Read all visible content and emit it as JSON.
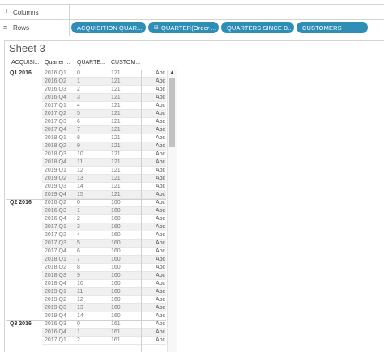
{
  "shelves": {
    "columns": {
      "label": "Columns",
      "icon": "columns-icon"
    },
    "rows": {
      "label": "Rows",
      "icon": "rows-icon",
      "pills": [
        {
          "label": "ACQUISITION QUAR...",
          "icon": ""
        },
        {
          "label": "QUARTER(Order ...",
          "icon": "calendar-icon"
        },
        {
          "label": "QUARTERS SINCE B...",
          "icon": ""
        },
        {
          "label": "CUSTOMERS",
          "icon": ""
        }
      ]
    }
  },
  "sheet": {
    "title": "Sheet 3",
    "headers": [
      "ACQUISI...",
      "Quarter ...",
      "QUARTE...",
      "CUSTOM..."
    ],
    "groups": [
      {
        "label": "Q1 2016",
        "rows": [
          [
            "2016 Q1",
            "0",
            "121",
            "Abc"
          ],
          [
            "2016 Q2",
            "1",
            "121",
            "Abc"
          ],
          [
            "2016 Q3",
            "2",
            "121",
            "Abc"
          ],
          [
            "2016 Q4",
            "3",
            "121",
            "Abc"
          ],
          [
            "2017 Q1",
            "4",
            "121",
            "Abc"
          ],
          [
            "2017 Q2",
            "5",
            "121",
            "Abc"
          ],
          [
            "2017 Q3",
            "6",
            "121",
            "Abc"
          ],
          [
            "2017 Q4",
            "7",
            "121",
            "Abc"
          ],
          [
            "2018 Q1",
            "8",
            "121",
            "Abc"
          ],
          [
            "2018 Q2",
            "9",
            "121",
            "Abc"
          ],
          [
            "2018 Q3",
            "10",
            "121",
            "Abc"
          ],
          [
            "2018 Q4",
            "11",
            "121",
            "Abc"
          ],
          [
            "2019 Q1",
            "12",
            "121",
            "Abc"
          ],
          [
            "2019 Q2",
            "13",
            "121",
            "Abc"
          ],
          [
            "2019 Q3",
            "14",
            "121",
            "Abc"
          ],
          [
            "2019 Q4",
            "15",
            "121",
            "Abc"
          ]
        ]
      },
      {
        "label": "Q2 2016",
        "rows": [
          [
            "2016 Q2",
            "0",
            "160",
            "Abc"
          ],
          [
            "2016 Q3",
            "1",
            "160",
            "Abc"
          ],
          [
            "2016 Q4",
            "2",
            "160",
            "Abc"
          ],
          [
            "2017 Q1",
            "3",
            "160",
            "Abc"
          ],
          [
            "2017 Q2",
            "4",
            "160",
            "Abc"
          ],
          [
            "2017 Q3",
            "5",
            "160",
            "Abc"
          ],
          [
            "2017 Q4",
            "6",
            "160",
            "Abc"
          ],
          [
            "2018 Q1",
            "7",
            "160",
            "Abc"
          ],
          [
            "2018 Q2",
            "8",
            "160",
            "Abc"
          ],
          [
            "2018 Q3",
            "9",
            "160",
            "Abc"
          ],
          [
            "2018 Q4",
            "10",
            "160",
            "Abc"
          ],
          [
            "2019 Q1",
            "11",
            "160",
            "Abc"
          ],
          [
            "2019 Q2",
            "12",
            "160",
            "Abc"
          ],
          [
            "2019 Q3",
            "13",
            "160",
            "Abc"
          ],
          [
            "2019 Q4",
            "14",
            "160",
            "Abc"
          ]
        ]
      },
      {
        "label": "Q3 2016",
        "rows": [
          [
            "2016 Q3",
            "0",
            "161",
            "Abc"
          ],
          [
            "2016 Q4",
            "1",
            "161",
            "Abc"
          ],
          [
            "2017 Q1",
            "2",
            "161",
            "Abc"
          ]
        ]
      }
    ]
  },
  "colors": {
    "pill": "#2e8eb5",
    "alt_row": "#f0f0f0",
    "scroll_thumb": "#c2c2c2"
  }
}
